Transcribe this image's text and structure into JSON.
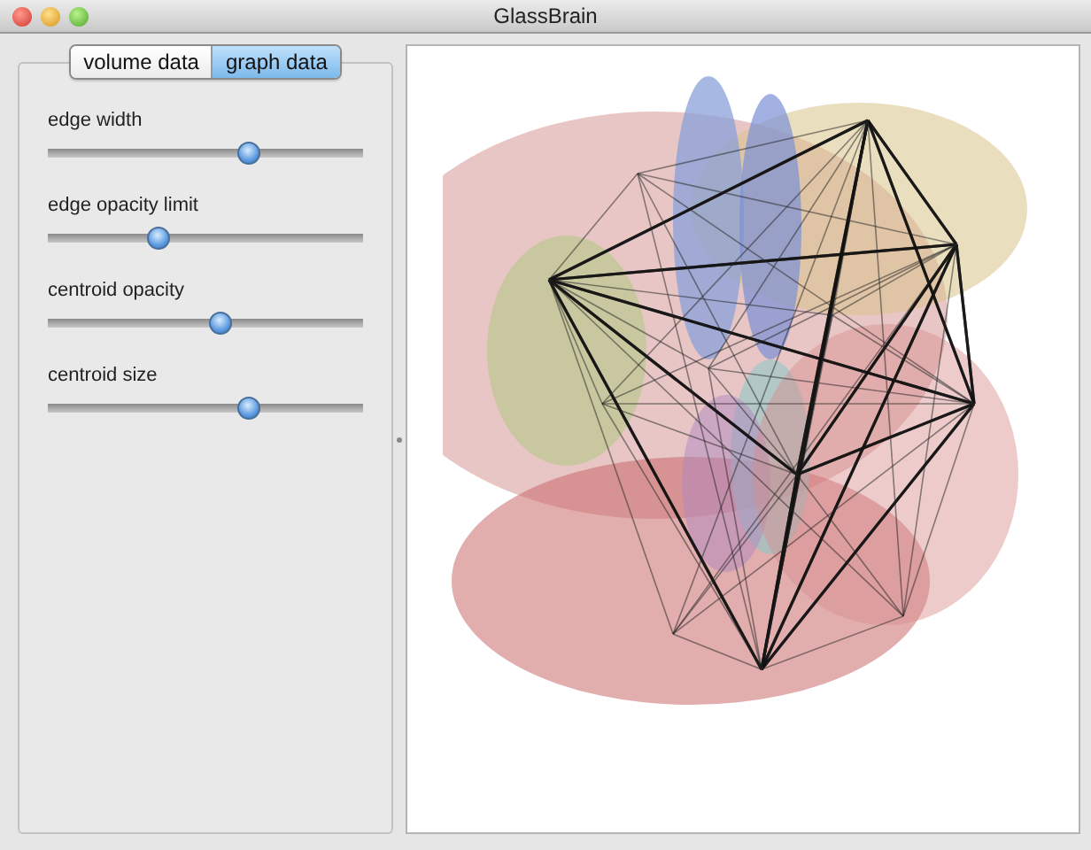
{
  "window": {
    "title": "GlassBrain"
  },
  "tabs": [
    {
      "label": "volume data",
      "selected": false
    },
    {
      "label": "graph data",
      "selected": true
    }
  ],
  "sliders": [
    {
      "label": "edge width",
      "level": 0.65
    },
    {
      "label": "edge opacity limit",
      "level": 0.34
    },
    {
      "label": "centroid opacity",
      "level": 0.55
    },
    {
      "label": "centroid size",
      "level": 0.65
    }
  ]
}
